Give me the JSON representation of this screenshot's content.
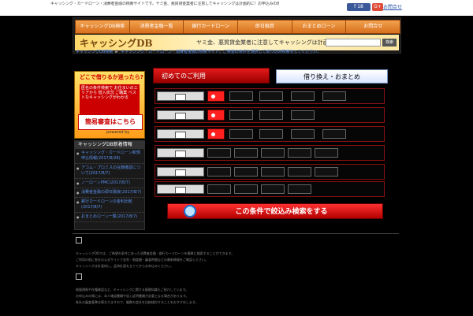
{
  "topbar": {
    "notice": "キャッシング・カードローン・消費者金融の検索サイトです。ヤミ金、悪質貸金業者に注意してキャッシングは計画的に！お申込みの際は必ず各社の公式サイトにて最新の情報をご確認ください。",
    "fb_label": "f 18",
    "gplus_label": "G+",
    "link_label": "お問合せ"
  },
  "nav": {
    "items": [
      "キャッシングDB検索",
      "消費者金融一覧",
      "銀行カードローン",
      "即日融資",
      "おまとめローン",
      "お問合せ"
    ]
  },
  "banner": {
    "logo": "キャッシングDB",
    "slogan": "ヤミ金、悪質貸金業者に注意してキャッシングは計画的に！",
    "search_placeholder": "",
    "search_button": "検索"
  },
  "breadcrumb": {
    "home": "キャッシングDB検索",
    "current": "キャッシング・カードローン・消費者金融の検索サイト。ご希望の条件を選択して絞り込み検索をしてください。"
  },
  "promo": {
    "title": "どこで借りるか迷ったら?",
    "body": "匿名の条件検索で お住まいのエリアから 借入状況 ご職業 ベストなキャッシングがわかる",
    "cta": "簡易審査はこちら",
    "powered": "powered by"
  },
  "news": {
    "heading": "キャッシングDB新着情報",
    "items": [
      "キャッシング・カードローン新規申込情報(2017/8/28)",
      "アコム・プロミスの在籍確認について(2017/8/7)",
      "ノーローンPMC(2017/8/7)",
      "消費者金融の即日融資(2017/8/7)",
      "銀行カードローンの金利比較(2017/8/7)",
      "おまとめローン一覧(2017/8/7)"
    ]
  },
  "tabs": {
    "first": "初めてのご利用",
    "second": "借り換え・おまとめ"
  },
  "search": {
    "button": "この条件で絞込み検索をする"
  },
  "content": {
    "lines": [
      "キャッシングDBでは、ご希望の条件にあった消費者金融・銀行カードローンを簡単に検索することができます。",
      "ご利用の前に各社の公式サイトで金利・限度額・審査時間などの最新情報をご確認ください。",
      "キャッシングは計画的に。返済計画を立ててからお申込みください。",
      "総量規制や在籍確認など、キャッシングに関する基礎知識もご紹介しています。",
      "",
      "お申込みの際には、本人確認書類や収入証明書類が必要となる場合があります。",
      "各社の審査基準は異なりますので、複数の会社を比較検討することをおすすめします。"
    ]
  }
}
